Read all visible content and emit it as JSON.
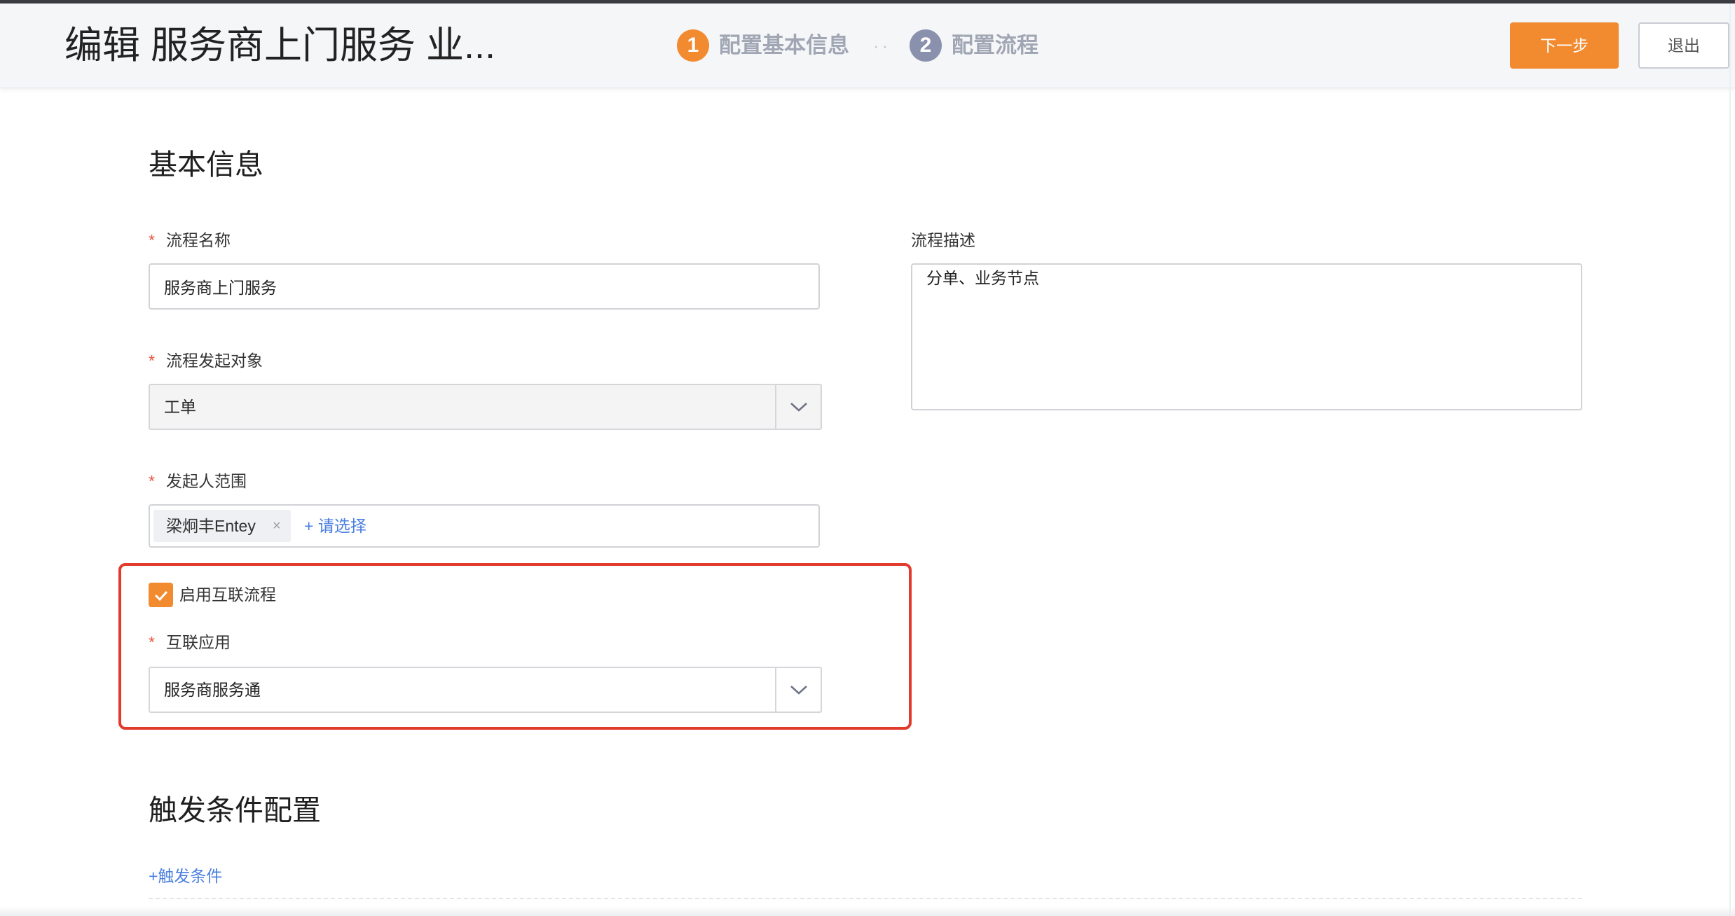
{
  "header": {
    "title": "编辑 服务商上门服务 业...",
    "steps": [
      {
        "number": "1",
        "label": "配置基本信息",
        "active": true
      },
      {
        "number": "2",
        "label": "配置流程",
        "active": false
      }
    ],
    "step_separator": "··",
    "next_button": "下一步",
    "exit_button": "退出"
  },
  "basic_info": {
    "heading": "基本信息",
    "required_mark": "*",
    "process_name": {
      "label": "流程名称",
      "value": "服务商上门服务"
    },
    "initiating_object": {
      "label": "流程发起对象",
      "value": "工单"
    },
    "initiator_scope": {
      "label": "发起人范围",
      "tags": [
        {
          "text": "梁炯丰Entey",
          "remove": "×"
        }
      ],
      "add_link": "+ 请选择"
    },
    "enable_interconnect": {
      "label": "启用互联流程",
      "checked": true
    },
    "interconnect_app": {
      "label": "互联应用",
      "value": "服务商服务通"
    },
    "description": {
      "label": "流程描述",
      "value": "分单、业务节点"
    }
  },
  "trigger_config": {
    "heading": "触发条件配置",
    "add_link": "+触发条件"
  },
  "icons": {
    "select_arrow": "chevron-down-icon",
    "checkbox_mark": "check-icon",
    "tag_remove": "close-icon"
  },
  "colors": {
    "accent": "#f28a30",
    "highlight": "#e23b2e",
    "link": "#4a7fe0",
    "step_inactive": "#8a91ad",
    "required": "#e8553f"
  }
}
